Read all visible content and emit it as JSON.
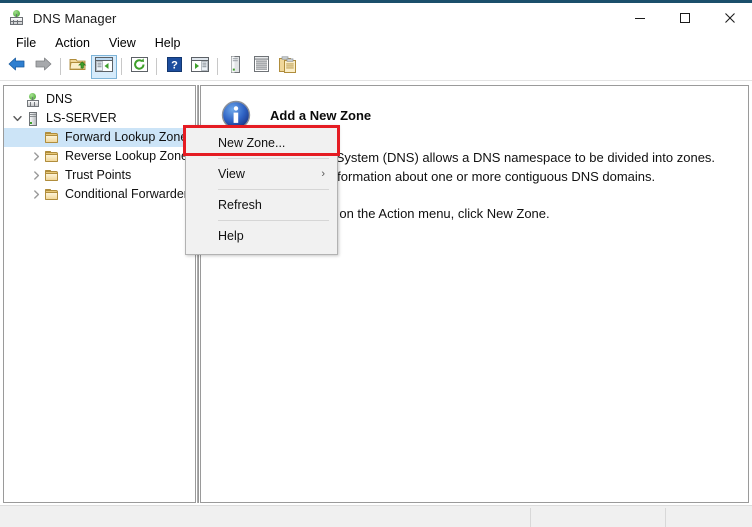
{
  "window": {
    "title": "DNS Manager",
    "icon": "dns-manager-icon",
    "accent_color": "#1b4f6b",
    "controls": [
      {
        "name": "minimize-button",
        "glyph": "minimize"
      },
      {
        "name": "maximize-button",
        "glyph": "maximize"
      },
      {
        "name": "close-button",
        "glyph": "close"
      }
    ]
  },
  "menubar": {
    "items": [
      {
        "label": "File",
        "name": "menu-file"
      },
      {
        "label": "Action",
        "name": "menu-action"
      },
      {
        "label": "View",
        "name": "menu-view"
      },
      {
        "label": "Help",
        "name": "menu-help"
      }
    ]
  },
  "toolbar": {
    "buttons": [
      {
        "name": "back-button",
        "icon": "back-arrow-icon",
        "selected": false
      },
      {
        "name": "forward-button",
        "icon": "forward-arrow-icon",
        "selected": false
      },
      {
        "name": "up-one-level-button",
        "icon": "folder-up-icon",
        "selected": false
      },
      {
        "name": "show-hide-console-tree-button",
        "icon": "console-tree-icon",
        "selected": true
      },
      {
        "name": "refresh-button",
        "icon": "refresh-icon",
        "selected": false
      },
      {
        "name": "help-button",
        "icon": "help-question-icon",
        "selected": false
      },
      {
        "name": "show-action-pane-button",
        "icon": "action-pane-icon",
        "selected": false
      },
      {
        "name": "new-server-button",
        "icon": "server-icon",
        "selected": false
      },
      {
        "name": "properties-button",
        "icon": "list-properties-icon",
        "selected": false
      },
      {
        "name": "copy-button",
        "icon": "copy-clipboard-icon",
        "selected": false
      }
    ]
  },
  "tree": {
    "nodes": [
      {
        "label": "DNS",
        "icon": "dns-root-icon",
        "indent": 0,
        "twisty": "none",
        "selected": false
      },
      {
        "label": "LS-SERVER",
        "icon": "server-icon",
        "indent": 1,
        "twisty": "expanded",
        "selected": false
      },
      {
        "label": "Forward Lookup Zones",
        "icon": "folder-icon",
        "indent": 2,
        "twisty": "none",
        "selected": true
      },
      {
        "label": "Reverse Lookup Zones",
        "icon": "folder-icon",
        "indent": 2,
        "twisty": "collapsed",
        "selected": false
      },
      {
        "label": "Trust Points",
        "icon": "folder-icon",
        "indent": 2,
        "twisty": "collapsed",
        "selected": false
      },
      {
        "label": "Conditional Forwarders",
        "icon": "folder-icon",
        "indent": 2,
        "twisty": "collapsed",
        "selected": false
      }
    ]
  },
  "content": {
    "icon": "information-icon",
    "title": "Add a New Zone",
    "paragraphs": [
      "The Domain Name System (DNS) allows a DNS namespace to be divided into zones. Each zone stores information about one or more contiguous DNS domains.",
      "To add a new zone, on the Action menu, click New Zone."
    ]
  },
  "context_menu": {
    "highlight_color": "#e51c23",
    "items": [
      {
        "label": "New Zone...",
        "name": "context-menu-new-zone",
        "highlighted": true,
        "submenu": false
      },
      {
        "label": "View",
        "name": "context-menu-view",
        "highlighted": false,
        "submenu": true
      },
      {
        "label": "Refresh",
        "name": "context-menu-refresh",
        "highlighted": false,
        "submenu": false
      },
      {
        "label": "Help",
        "name": "context-menu-help",
        "highlighted": false,
        "submenu": false
      }
    ],
    "submenu_arrow": "›"
  },
  "statusbar": {
    "text": ""
  }
}
